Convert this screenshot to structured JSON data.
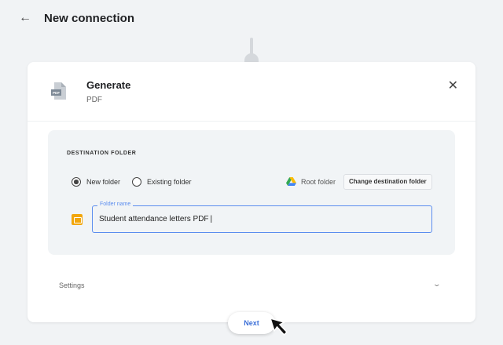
{
  "header": {
    "back_icon": "arrow-left-icon",
    "title": "New connection"
  },
  "card": {
    "title": "Generate",
    "subtitle": "PDF",
    "icon": "pdf-file-icon",
    "icon_text": "PDF",
    "close_icon": "close-icon"
  },
  "destination": {
    "label": "DESTINATION FOLDER",
    "options": [
      {
        "label": "New folder",
        "selected": true
      },
      {
        "label": "Existing folder",
        "selected": false
      }
    ],
    "root_label": "Root folder",
    "root_icon": "google-drive-icon",
    "change_button": "Change destination folder"
  },
  "folder_field": {
    "label": "Folder name",
    "value": "Student attendance letters PDF",
    "icon": "folder-icon",
    "accent": "#5b8def"
  },
  "settings": {
    "label": "Settings",
    "chevron": "chevron-down-icon"
  },
  "next_button": "Next"
}
